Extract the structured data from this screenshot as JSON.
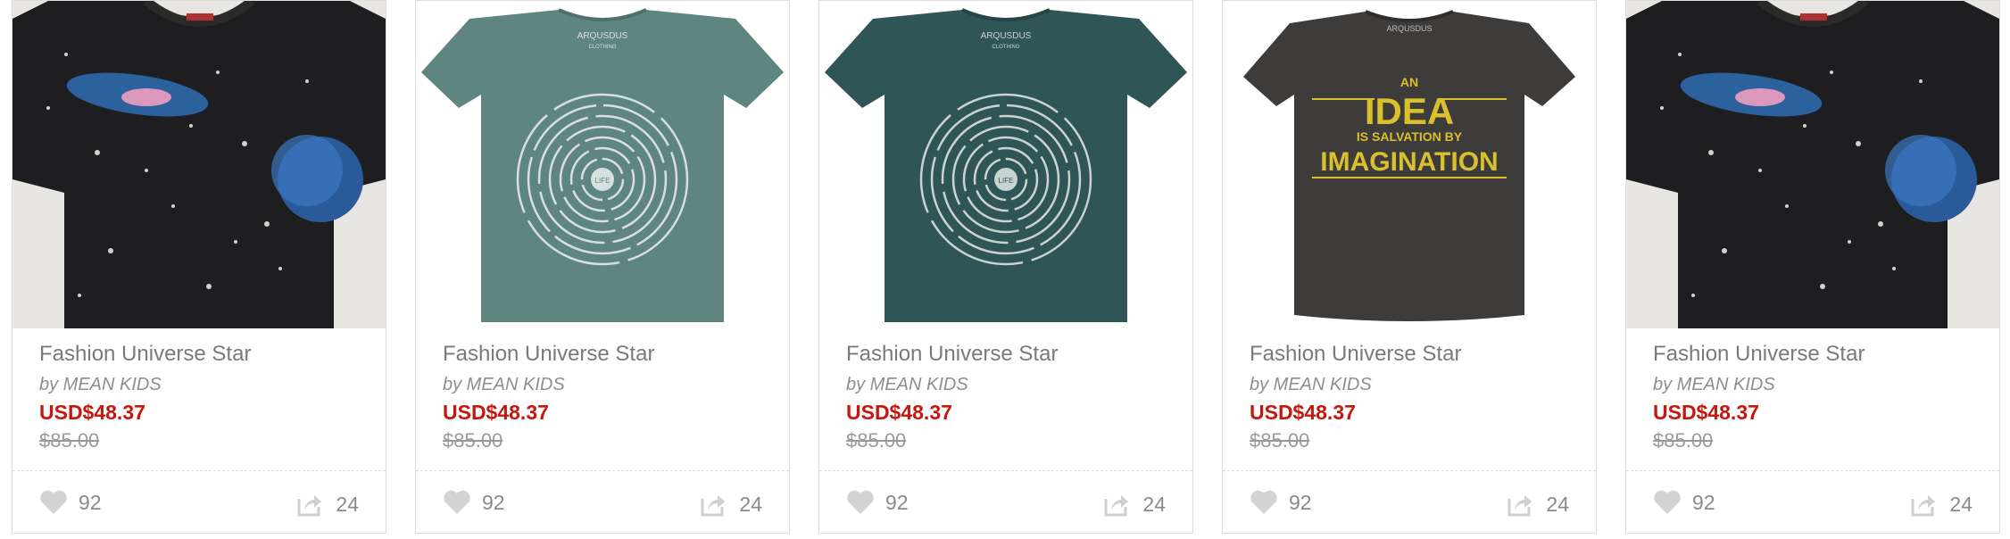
{
  "products": [
    {
      "image": "galaxy-print-tshirt",
      "title": "Fashion Universe Star",
      "byline": "by MEAN KIDS",
      "price": "USD$48.37",
      "old_price": "$85.00",
      "likes": "92",
      "shares": "24"
    },
    {
      "image": "sage-maze-tshirt",
      "title": "Fashion Universe Star",
      "byline": "by MEAN KIDS",
      "price": "USD$48.37",
      "old_price": "$85.00",
      "likes": "92",
      "shares": "24"
    },
    {
      "image": "teal-maze-tshirt",
      "title": "Fashion Universe Star",
      "byline": "by MEAN KIDS",
      "price": "USD$48.37",
      "old_price": "$85.00",
      "likes": "92",
      "shares": "24"
    },
    {
      "image": "idea-imagination-tshirt",
      "title": "Fashion Universe Star",
      "byline": "by MEAN KIDS",
      "price": "USD$48.37",
      "old_price": "$85.00",
      "likes": "92",
      "shares": "24"
    },
    {
      "image": "galaxy-print-tshirt",
      "title": "Fashion Universe Star",
      "byline": "by MEAN KIDS",
      "price": "USD$48.37",
      "old_price": "$85.00",
      "likes": "92",
      "shares": "24"
    }
  ],
  "shirt_text": {
    "brand": "ARQUSDUS",
    "brand_sub": "CLOTHING",
    "maze_center": "LIFE",
    "idea_line1": "AN",
    "idea_line2": "IDEA",
    "idea_line3": "IS SALVATION BY",
    "idea_line4": "IMAGINATION"
  },
  "colors": {
    "price": "#c4180f",
    "galaxy_shirt": "#1e1e20",
    "sage_shirt": "#5f8580",
    "teal_shirt": "#2f5556",
    "charcoal_shirt": "#3d3c3b",
    "idea_print": "#d9c02c"
  }
}
